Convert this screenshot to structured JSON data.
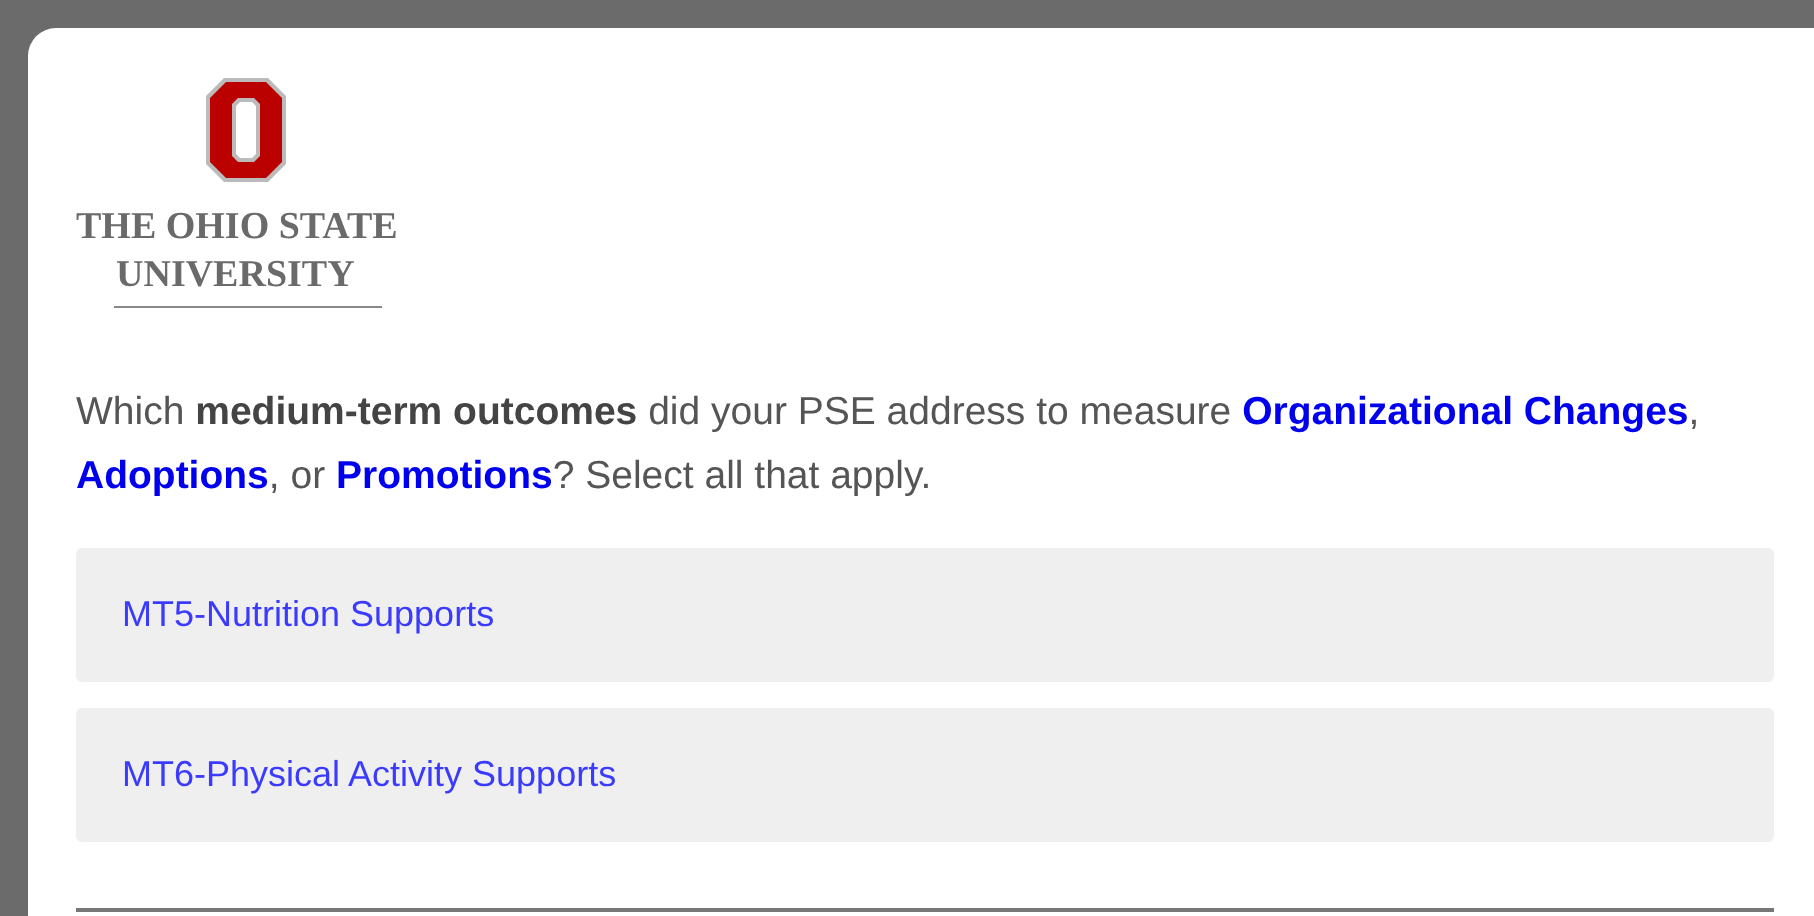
{
  "logo": {
    "line_1": "THE OHIO STATE",
    "line_2": "UNIVERSITY"
  },
  "question": [
    {
      "kind": "plain",
      "text": "Which "
    },
    {
      "kind": "bold",
      "text": "medium-term outcomes"
    },
    {
      "kind": "plain",
      "text": " did your PSE address to measure "
    },
    {
      "kind": "link",
      "text": "Organizational Changes"
    },
    {
      "kind": "plain",
      "text": ", "
    },
    {
      "kind": "link",
      "text": "Adoptions"
    },
    {
      "kind": "plain",
      "text": ", or "
    },
    {
      "kind": "link",
      "text": "Promotions"
    },
    {
      "kind": "plain",
      "text": "?  Select all that apply."
    }
  ],
  "choices": [
    {
      "label": "MT5-Nutrition Supports",
      "selected": false
    },
    {
      "label": "MT6-Physical Activity Supports",
      "selected": false
    }
  ]
}
